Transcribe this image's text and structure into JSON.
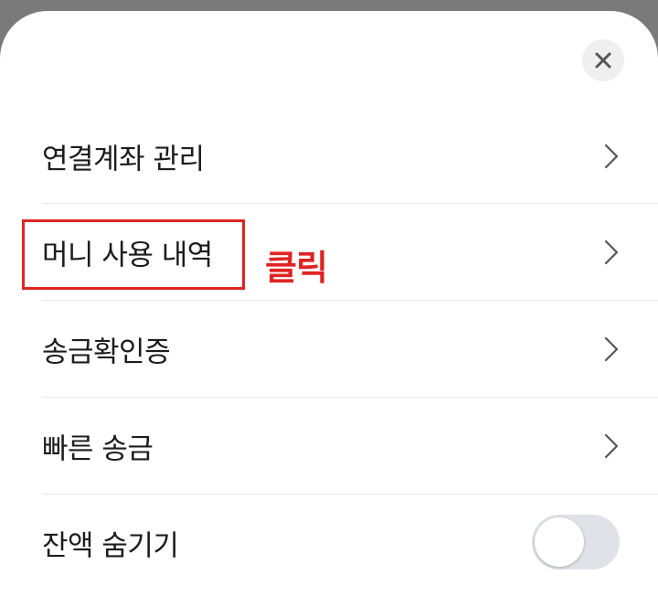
{
  "close_icon": "close-icon",
  "menu": {
    "items": [
      {
        "label": "연결계좌 관리",
        "icon": "chevron-right-icon"
      },
      {
        "label": "머니 사용 내역",
        "icon": "chevron-right-icon"
      },
      {
        "label": "송금확인증",
        "icon": "chevron-right-icon"
      },
      {
        "label": "빠른 송금",
        "icon": "chevron-right-icon"
      },
      {
        "label": "잔액 숨기기",
        "toggle_on": false
      }
    ]
  },
  "annotation": {
    "text": "클릭",
    "color": "#e02424"
  },
  "colors": {
    "overlay": "#7a7a7a",
    "sheet": "#ffffff",
    "toggle_track_off": "#dfe3e8"
  }
}
